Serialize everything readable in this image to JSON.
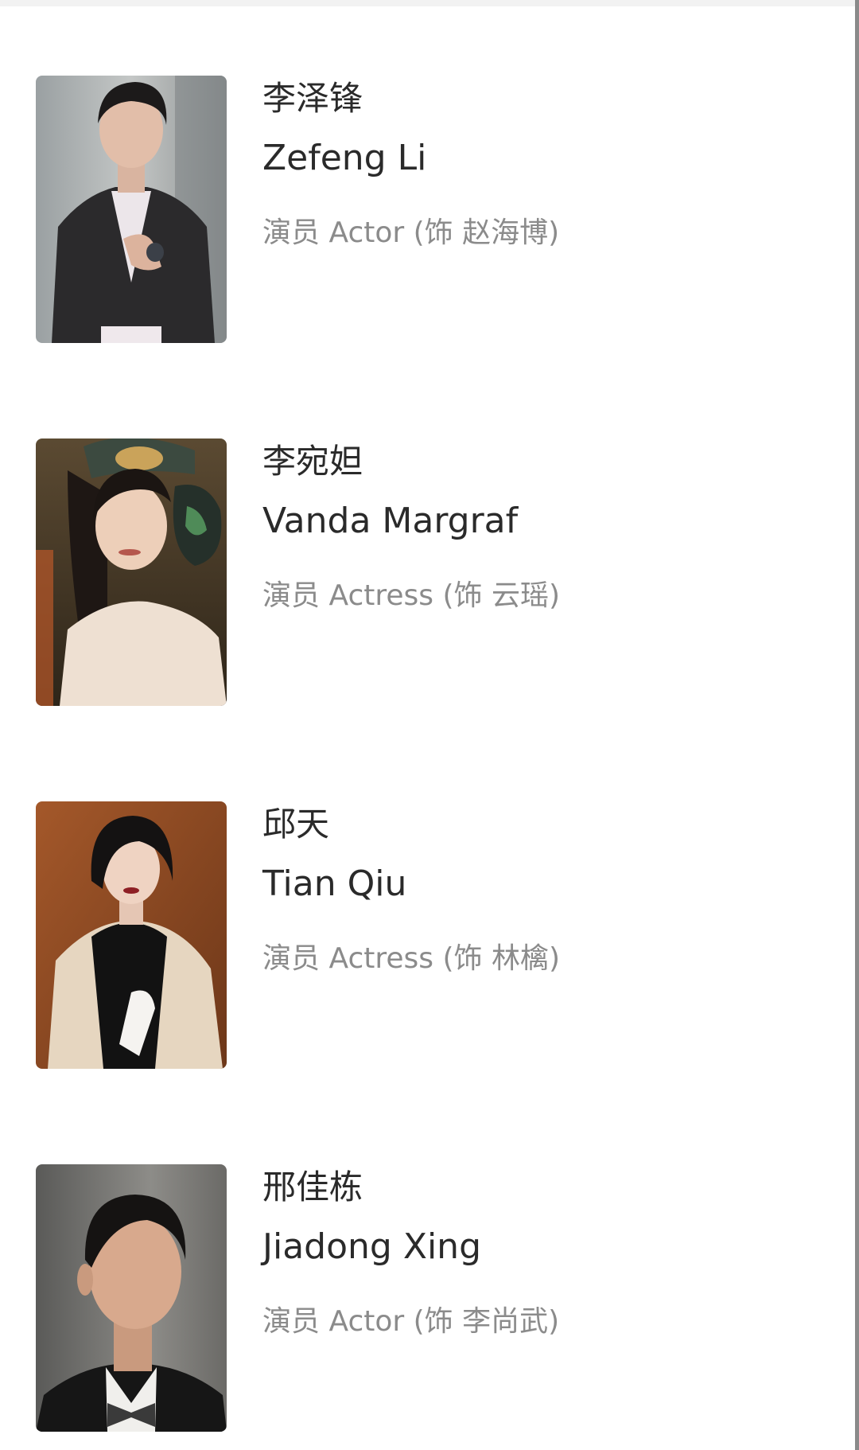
{
  "cast": [
    {
      "name_cn": "李泽锋",
      "name_en": "Zefeng Li",
      "role": "演员 Actor (饰 赵海博)"
    },
    {
      "name_cn": "李宛妲",
      "name_en": "Vanda Margraf",
      "role": "演员 Actress (饰 云瑶)"
    },
    {
      "name_cn": "邱天",
      "name_en": "Tian Qiu",
      "role": "演员 Actress (饰 林檎)"
    },
    {
      "name_cn": "邢佳栋",
      "name_en": "Jiadong Xing",
      "role": "演员 Actor (饰 李尚武)"
    }
  ],
  "colors": {
    "background": "#ffffff",
    "primary_text": "#2a2a2a",
    "secondary_text": "#8b8b8b"
  }
}
